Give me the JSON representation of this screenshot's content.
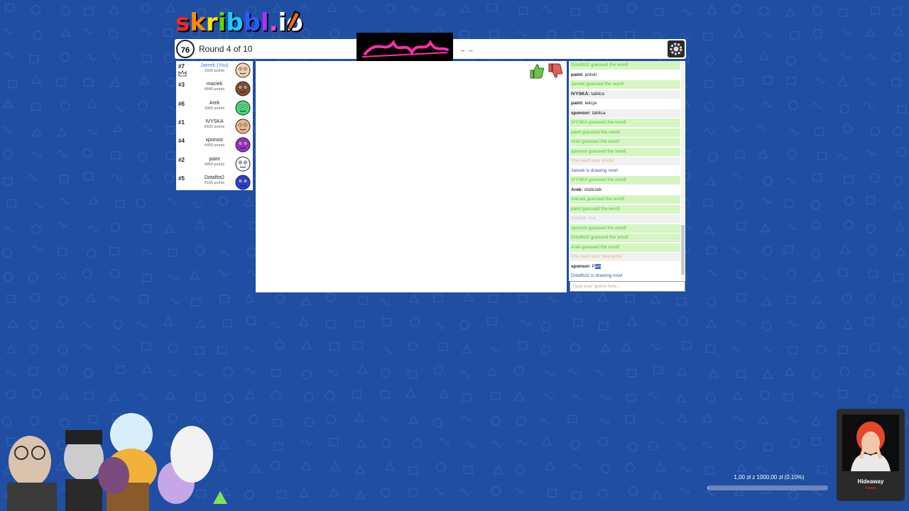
{
  "logo": {
    "text": "skribbl.io",
    "letters": [
      {
        "ch": "s",
        "color": "#ef2a1f"
      },
      {
        "ch": "k",
        "color": "#ff8a00"
      },
      {
        "ch": "r",
        "color": "#ffe400"
      },
      {
        "ch": "i",
        "color": "#5fd600"
      },
      {
        "ch": "b",
        "color": "#21c7ff"
      },
      {
        "ch": "b",
        "color": "#2a5cff"
      },
      {
        "ch": "l",
        "color": "#a534ff"
      },
      {
        "ch": ".",
        "color": "#ff3fc9"
      },
      {
        "ch": "i",
        "color": "#ffffff"
      },
      {
        "ch": "o",
        "color": "#ffffff"
      }
    ]
  },
  "topbar": {
    "timer": "76",
    "round": "Round 4 of 10",
    "word_hint": "_ _"
  },
  "players": [
    {
      "rank": "#7",
      "name": "Jareek (You)",
      "points": "3930 points",
      "me": true,
      "avatar_color": "#f6d6a8"
    },
    {
      "rank": "#3",
      "name": "maciek",
      "points": "4840 points",
      "me": false,
      "avatar_color": "#8a4b2a"
    },
    {
      "rank": "#6",
      "name": "Arek",
      "points": "3965 points",
      "me": false,
      "avatar_color": "#3fdc77"
    },
    {
      "rank": "#1",
      "name": "IVYSKA",
      "points": "5620 points",
      "me": false,
      "avatar_color": "#f0b48a"
    },
    {
      "rank": "#4",
      "name": "sponsor",
      "points": "4400 points",
      "me": false,
      "avatar_color": "#a12cc9"
    },
    {
      "rank": "#2",
      "name": "paint",
      "points": "4850 points",
      "me": false,
      "avatar_color": "#ffffff"
    },
    {
      "rank": "#5",
      "name": "Dotalfot2",
      "points": "4105 points",
      "me": false,
      "avatar_color": "#2840d8"
    }
  ],
  "chat": [
    {
      "kind": "green",
      "text": "Dotalfot2 guessed the word!"
    },
    {
      "kind": "white",
      "user": "paint:",
      "text": "polski"
    },
    {
      "kind": "green",
      "text": "Jareek guessed the word!"
    },
    {
      "kind": "gray",
      "user": "IVYSKA:",
      "text": "tablica"
    },
    {
      "kind": "white",
      "user": "paint:",
      "text": "lekcja"
    },
    {
      "kind": "gray",
      "user": "sponsor:",
      "text": "tablica"
    },
    {
      "kind": "green",
      "text": "IVYSKA guessed the word!"
    },
    {
      "kind": "green",
      "text": "paint guessed the word!"
    },
    {
      "kind": "green",
      "text": "Arek guessed the word!"
    },
    {
      "kind": "green",
      "text": "sponsor guessed the word!"
    },
    {
      "kind": "gray-orange",
      "text": "The word was 'kreda'"
    },
    {
      "kind": "blue",
      "text": "Jareek is drawing now!"
    },
    {
      "kind": "green",
      "text": "IVYSKA guessed the word!"
    },
    {
      "kind": "white",
      "user": "Arek:",
      "text": "stoliczek"
    },
    {
      "kind": "green",
      "text": "maciek guessed the word!"
    },
    {
      "kind": "green",
      "text": "paint guessed the word!"
    },
    {
      "kind": "gray-light",
      "text": "maciek: osa"
    },
    {
      "kind": "green",
      "text": "sponsor guessed the word!"
    },
    {
      "kind": "green",
      "text": "Dotalfot2 guessed the word!"
    },
    {
      "kind": "green",
      "text": "Arek guessed the word!"
    },
    {
      "kind": "gray-orange",
      "text": "The word was 'klepsydra'"
    },
    {
      "kind": "white-sel",
      "user": "sponsor:",
      "text": "P",
      "sel": "ies"
    },
    {
      "kind": "blue",
      "text": "Dotalfot2 is drawing now!"
    }
  ],
  "guess_placeholder": "Type your guess here...",
  "donation": {
    "text": "1,00 zł z 1000,00 zł (0.10%)",
    "fraction": 0.001
  },
  "music": {
    "title": "Hideaway",
    "artist": "Kiesza"
  },
  "colors": {
    "background": "#1f4ea3",
    "guessed": "#4cc734",
    "drawing": "#3a4fd6",
    "word_reveal": "#e2b37c"
  }
}
